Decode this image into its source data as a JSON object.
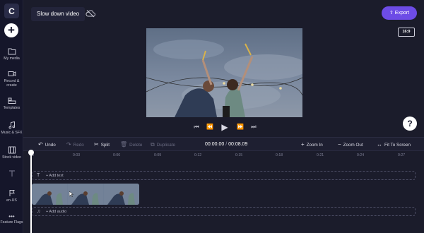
{
  "app": {
    "logo_letter": "C",
    "project_title": "Slow down video",
    "export_label": "Export",
    "aspect_ratio": "16:9",
    "help_label": "?"
  },
  "sidebar": {
    "items": [
      {
        "icon": "folder-icon",
        "label": "My media"
      },
      {
        "icon": "camera-icon",
        "label": "Record & create"
      },
      {
        "icon": "templates-icon",
        "label": "Templates"
      },
      {
        "icon": "music-icon",
        "label": "Music & SFX"
      },
      {
        "icon": "film-icon",
        "label": "Stock video"
      },
      {
        "icon": "text-icon",
        "label": ""
      },
      {
        "icon": "flag-icon",
        "label": "en-US"
      },
      {
        "icon": "more-icon",
        "label": "Feature Flags"
      }
    ]
  },
  "toolbar": {
    "undo": "Undo",
    "redo": "Redo",
    "split": "Split",
    "delete": "Delete",
    "duplicate": "Duplicate",
    "time_current": "00:00.00",
    "time_separator": " / ",
    "time_total": "00:08.09",
    "zoom_in": "Zoom In",
    "zoom_out": "Zoom Out",
    "fit_to_screen": "Fit To Screen"
  },
  "ruler": {
    "ticks": [
      "0",
      "0:03",
      "0:06",
      "0:09",
      "0:12",
      "0:15",
      "0:18",
      "0:21",
      "0:24",
      "0:27"
    ]
  },
  "timeline": {
    "text_track_label": "+ Add text",
    "audio_track_label": "+ Add audio"
  },
  "colors": {
    "accent": "#6d4ce6",
    "background": "#1b1c2b",
    "sidebar": "#15162a"
  }
}
